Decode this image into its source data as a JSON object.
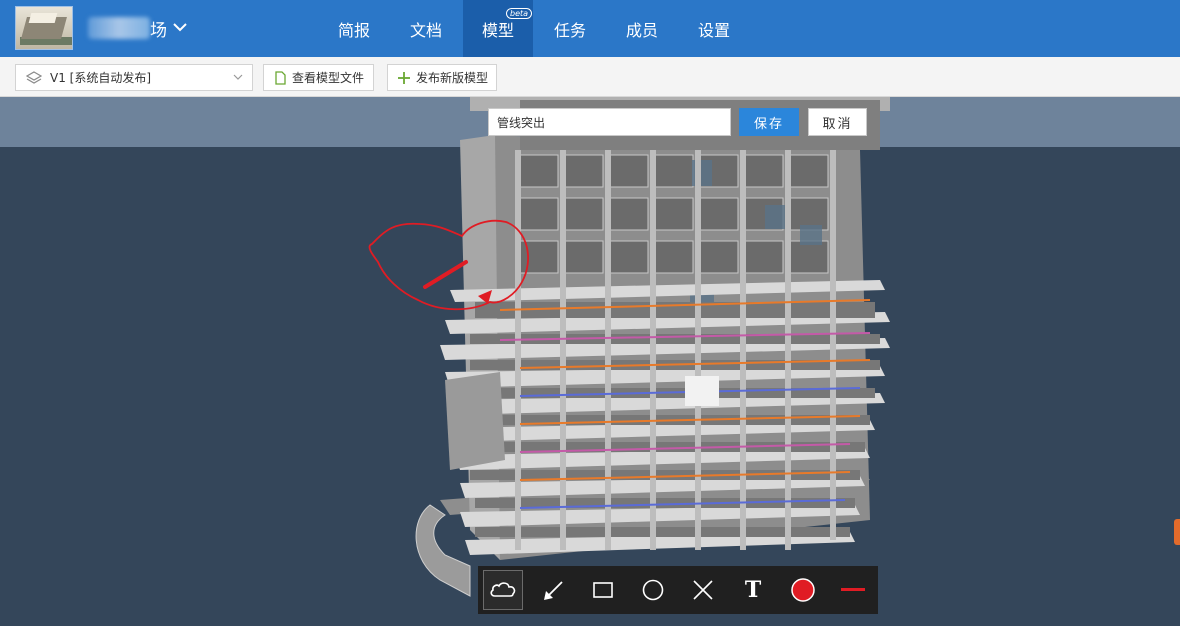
{
  "header": {
    "project_name_visible": "场",
    "project_name_prefix_faint": "广",
    "tabs": [
      {
        "label": "简报",
        "active": false
      },
      {
        "label": "文档",
        "active": false
      },
      {
        "label": "模型",
        "active": true,
        "badge": "beta"
      },
      {
        "label": "任务",
        "active": false
      },
      {
        "label": "成员",
        "active": false
      },
      {
        "label": "设置",
        "active": false
      }
    ]
  },
  "toolbar": {
    "version_select": "V1 [系统自动发布]",
    "view_files_label": "查看模型文件",
    "publish_label": "发布新版模型"
  },
  "annotation": {
    "input_value": "管线突出",
    "save_label": "保存",
    "cancel_label": "取消"
  },
  "markup_tools": [
    {
      "name": "cloud-icon",
      "selected": true
    },
    {
      "name": "arrow-icon",
      "selected": false
    },
    {
      "name": "rectangle-icon",
      "selected": false
    },
    {
      "name": "circle-icon",
      "selected": false
    },
    {
      "name": "cross-icon",
      "selected": false
    },
    {
      "name": "text-icon",
      "selected": false,
      "glyph": "T"
    },
    {
      "name": "color-picker-icon",
      "selected": false
    },
    {
      "name": "line-width-icon",
      "selected": false
    }
  ],
  "colors": {
    "header_bg": "#2b77c8",
    "active_tab_bg": "#1b5eaa",
    "viewport_bg": "#34465a",
    "markup_red": "#e01c24",
    "save_button": "#2b86db"
  }
}
